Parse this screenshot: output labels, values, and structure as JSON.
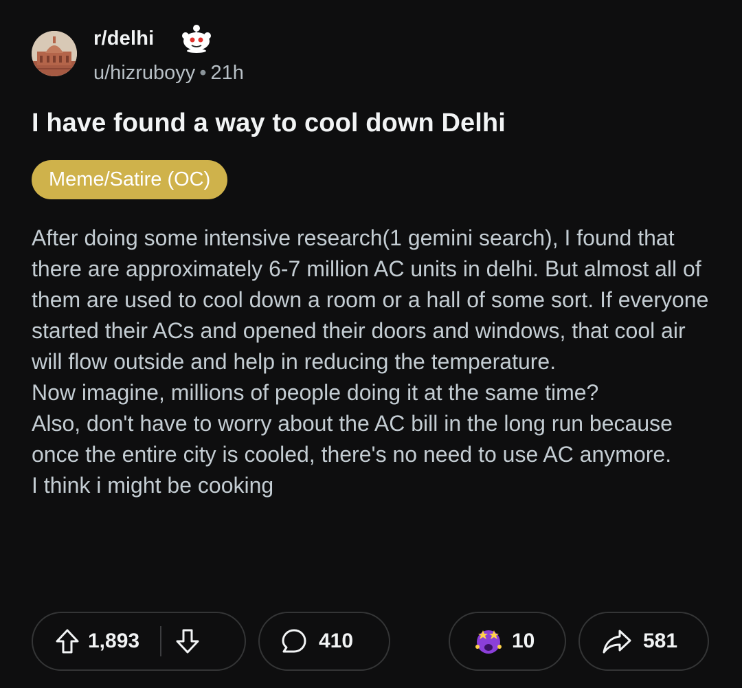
{
  "post": {
    "subreddit": "r/delhi",
    "author": "u/hizruboyy",
    "separator": "•",
    "time_ago": "21h",
    "title": "I have found a way to cool down Delhi",
    "flair": "Meme/Satire (OC)",
    "body_paragraphs": [
      "After doing some intensive research(1 gemini search), I found that there are approximately 6-7 million AC units in delhi. But almost all of them are used to cool down a room or a hall of some sort. If everyone started their ACs and opened their doors and windows, that cool air will flow outside and help in reducing the temperature.",
      "Now imagine, millions of people doing it at the same time?",
      "Also, don't have to worry about the AC bill in the long run because once the entire city is cooled, there's no need to use AC anymore.",
      "I think i might be cooking"
    ]
  },
  "actions": {
    "upvotes": "1,893",
    "comments": "410",
    "awards": "10",
    "shares": "581"
  },
  "icons": {
    "avatar": "subreddit-avatar-monument",
    "snoo": "reddit-snoo-icon",
    "upvote": "upvote-arrow-icon",
    "downvote": "downvote-arrow-icon",
    "comment": "comment-bubble-icon",
    "award": "award-emoji-icon",
    "share": "share-arrow-icon"
  },
  "colors": {
    "background": "#0e0e0f",
    "flair": "#cfb24b",
    "text_primary": "#f2f4f5",
    "text_body": "#c4cdd3",
    "border": "#343536"
  }
}
